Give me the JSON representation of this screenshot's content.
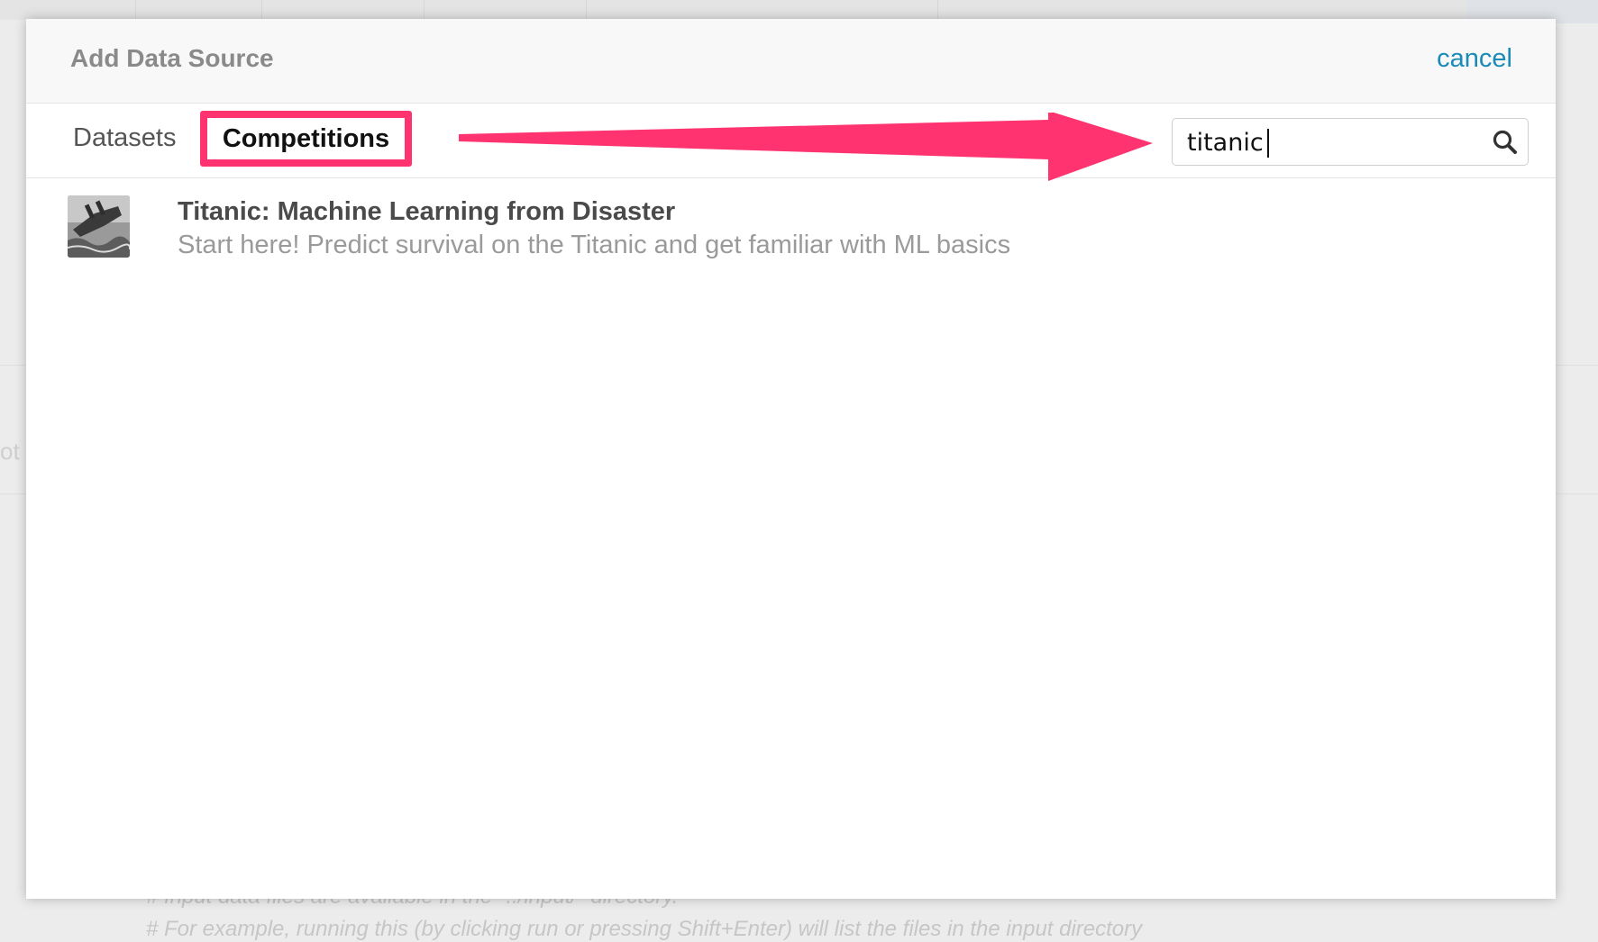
{
  "background": {
    "fragment": "ot",
    "code_lines": [
      "# Input data files are available in the \"../input/\" directory.",
      "# For example, running this (by clicking run or pressing Shift+Enter) will list the files in the input directory"
    ]
  },
  "modal": {
    "title": "Add Data Source",
    "cancel_label": "cancel",
    "tabs": [
      {
        "label": "Datasets",
        "active": false
      },
      {
        "label": "Competitions",
        "active": true
      }
    ],
    "search": {
      "value": "titanic",
      "icon": "search-icon"
    },
    "results": [
      {
        "title": "Titanic: Machine Learning from Disaster",
        "description": "Start here! Predict survival on the Titanic and get familiar with ML basics",
        "thumbnail": "titanic-ship-thumbnail"
      }
    ]
  },
  "colors": {
    "highlight": "#ff3370",
    "link": "#1a8ab9"
  }
}
